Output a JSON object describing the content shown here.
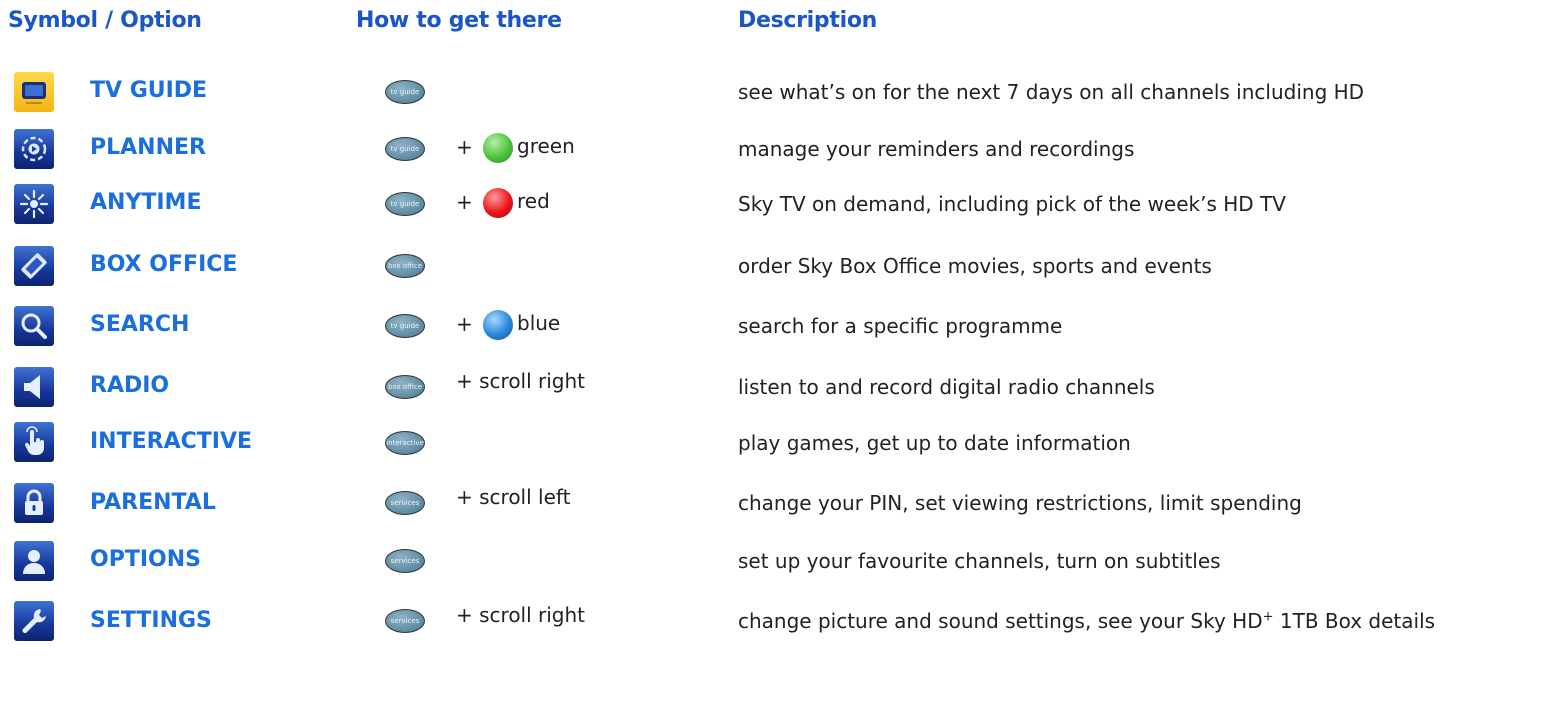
{
  "headers": {
    "col1": "Symbol / Option",
    "col2": "How to get there",
    "col3": "Description"
  },
  "rows": [
    {
      "icon": "tv-icon",
      "option": "TV GUIDE",
      "button": "tv guide",
      "plus": "",
      "key_text": "",
      "key_color": "",
      "description": "see what’s on for the next 7 days on all channels including HD"
    },
    {
      "icon": "planner-icon",
      "option": "PLANNER",
      "button": "tv guide",
      "plus": "+",
      "key_text": "green",
      "key_color": "#3bb34a",
      "description": "manage your reminders and recordings"
    },
    {
      "icon": "anytime-icon",
      "option": "ANYTIME",
      "button": "tv guide",
      "plus": "+",
      "key_text": "red",
      "key_color": "#e8101a",
      "description": "Sky TV on demand, including pick of the week’s HD TV"
    },
    {
      "icon": "ticket-icon",
      "option": "BOX OFFICE",
      "button": "box office",
      "plus": "",
      "key_text": "",
      "key_color": "",
      "description": "order Sky Box Office movies, sports and events"
    },
    {
      "icon": "magnifier-icon",
      "option": "SEARCH",
      "button": "tv guide",
      "plus": "+",
      "key_text": "blue",
      "key_color": "#2a86d9",
      "description": "search for a specific programme"
    },
    {
      "icon": "speaker-icon",
      "option": "RADIO",
      "button": "box office",
      "plus": "+ scroll right",
      "key_text": "",
      "key_color": "",
      "description": "listen to and record digital radio channels"
    },
    {
      "icon": "pointing-hand-icon",
      "option": "INTERACTIVE",
      "button": "interactive",
      "plus": "",
      "key_text": "",
      "key_color": "",
      "description": "play games, get up to date information"
    },
    {
      "icon": "padlock-icon",
      "option": "PARENTAL",
      "button": "services",
      "plus": "+ scroll left",
      "key_text": "",
      "key_color": "",
      "description": "change your PIN, set viewing restrictions, limit spending"
    },
    {
      "icon": "person-icon",
      "option": "OPTIONS",
      "button": "services",
      "plus": "",
      "key_text": "",
      "key_color": "",
      "description": "set up your favourite channels, turn on subtitles"
    },
    {
      "icon": "wrench-icon",
      "option": "SETTINGS",
      "button": "services",
      "plus": "+ scroll right",
      "key_text": "",
      "key_color": "",
      "description": "change picture and sound settings, see your Sky HD+ 1TB Box details"
    }
  ]
}
